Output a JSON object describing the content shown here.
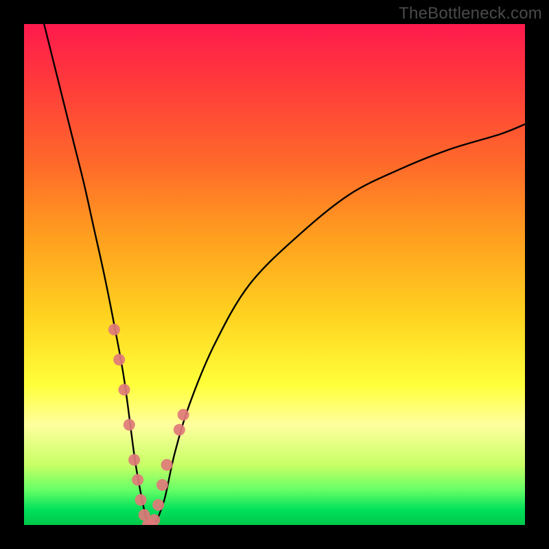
{
  "watermark": "TheBottleneck.com",
  "chart_data": {
    "type": "line",
    "title": "",
    "xlabel": "",
    "ylabel": "",
    "xlim": [
      0,
      100
    ],
    "ylim": [
      0,
      100
    ],
    "series": [
      {
        "name": "bottleneck-curve",
        "x": [
          4,
          6,
          8,
          10,
          12,
          14,
          16,
          18,
          20,
          22,
          23,
          24,
          25,
          26,
          28,
          30,
          33,
          38,
          45,
          55,
          65,
          75,
          85,
          95,
          100
        ],
        "values": [
          100,
          92,
          84,
          76,
          68,
          59,
          50,
          40,
          29,
          14,
          8,
          3,
          0,
          0,
          5,
          14,
          24,
          36,
          48,
          58,
          66,
          71,
          75,
          78,
          80
        ]
      }
    ],
    "markers": {
      "name": "highlight-dots",
      "x": [
        18,
        19,
        20,
        21,
        22,
        22.7,
        23.3,
        24,
        24.7,
        25.3,
        26,
        26.8,
        27.6,
        28.5,
        31,
        31.8
      ],
      "values": [
        39,
        33,
        27,
        20,
        13,
        9,
        5,
        2,
        0,
        0,
        1,
        4,
        8,
        12,
        19,
        22
      ]
    },
    "gradient_stops": [
      {
        "pos": 0,
        "color": "#ff1a4d"
      },
      {
        "pos": 12,
        "color": "#ff3b3b"
      },
      {
        "pos": 28,
        "color": "#ff6a2a"
      },
      {
        "pos": 42,
        "color": "#ff9d1f"
      },
      {
        "pos": 58,
        "color": "#ffd21f"
      },
      {
        "pos": 72,
        "color": "#ffff3a"
      },
      {
        "pos": 80,
        "color": "#ffff9e"
      },
      {
        "pos": 88,
        "color": "#c8ff66"
      },
      {
        "pos": 93,
        "color": "#66ff66"
      },
      {
        "pos": 97,
        "color": "#00e05a"
      },
      {
        "pos": 100,
        "color": "#00c84a"
      }
    ],
    "colors": {
      "curve": "#000000",
      "marker": "#e07a7a",
      "frame": "#000000"
    }
  }
}
